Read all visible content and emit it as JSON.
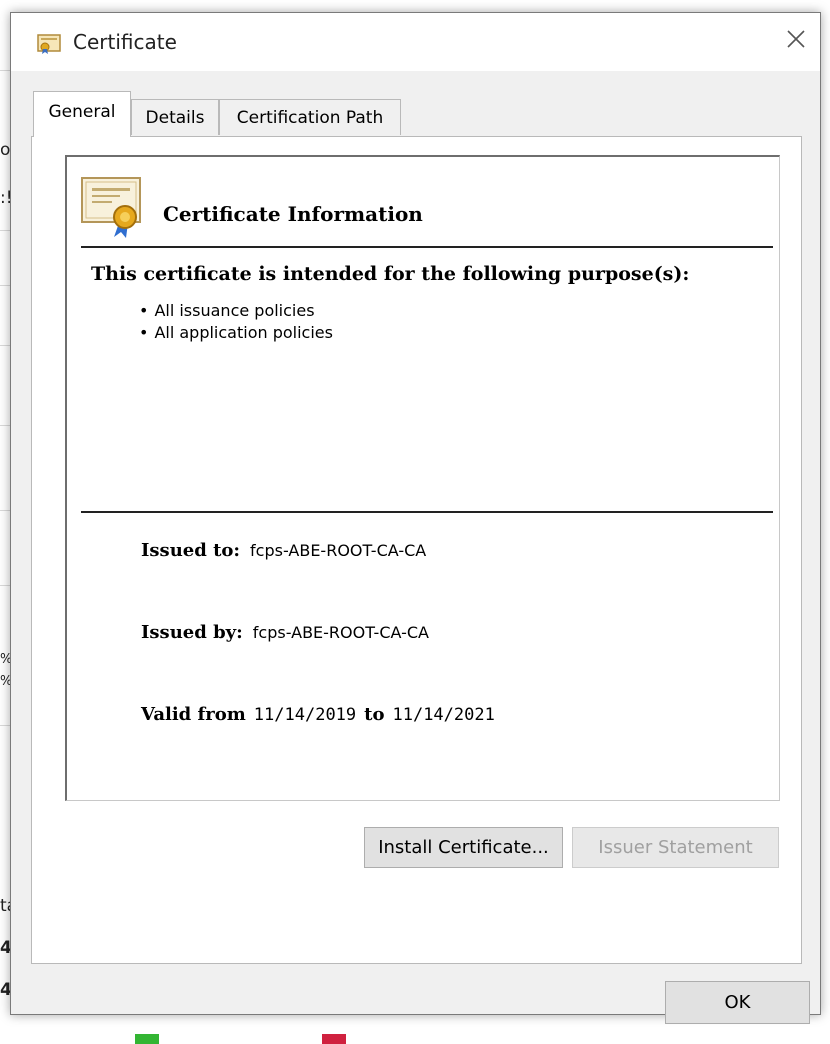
{
  "background": {
    "fragments": [
      "ou",
      ":!",
      "%",
      "%",
      "ta",
      "4",
      "4"
    ]
  },
  "window": {
    "title": "Certificate",
    "icon": "certificate-icon",
    "close_icon": "close-icon"
  },
  "tabs": [
    {
      "label": "General",
      "active": true
    },
    {
      "label": "Details",
      "active": false
    },
    {
      "label": "Certification Path",
      "active": false
    }
  ],
  "info": {
    "title": "Certificate Information",
    "icon": "certificate-ribbon-icon",
    "purpose_heading": "This certificate is intended for the following purpose(s):",
    "purposes": [
      "All issuance policies",
      "All application policies"
    ],
    "issued_to_label": "Issued to:",
    "issued_to_value": "fcps-ABE-ROOT-CA-CA",
    "issued_by_label": "Issued by:",
    "issued_by_value": "fcps-ABE-ROOT-CA-CA",
    "valid_from_label": "Valid from",
    "valid_from": "11/14/2019",
    "valid_to_label": "to",
    "valid_to": "11/14/2021"
  },
  "buttons": {
    "install": "Install Certificate...",
    "issuer_statement": "Issuer Statement",
    "ok": "OK"
  },
  "colors": {
    "dialog_bg": "#f0f0f0",
    "panel_bg": "#ffffff",
    "button_bg": "#e1e1e1",
    "disabled_text": "#a0a0a0"
  }
}
